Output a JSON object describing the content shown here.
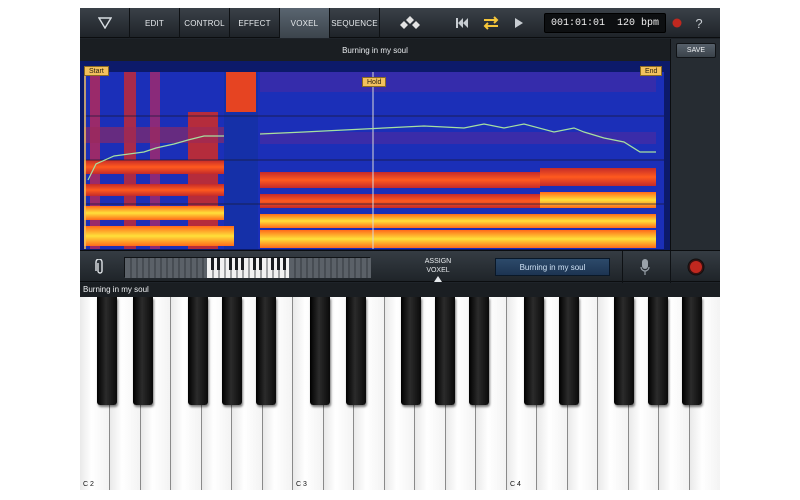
{
  "toolbar": {
    "tabs": [
      "EDIT",
      "CONTROL",
      "EFFECT",
      "VOXEL",
      "SEQUENCE"
    ],
    "active_tab": "VOXEL",
    "time": "001:01:01",
    "tempo": "120 bpm",
    "help": "?"
  },
  "editor": {
    "track_title": "Burning in my soul",
    "marker_start": "Start",
    "marker_hold": "Hold",
    "marker_end": "End",
    "save_label": "SAVE"
  },
  "control_bar": {
    "assign_line1": "ASSIGN",
    "assign_line2": "VOXEL",
    "phrase": "Burning in my soul"
  },
  "keyboard": {
    "phrase_label": "Burning in my soul",
    "octave_labels": [
      "C 2",
      "C 3",
      "C 4"
    ]
  },
  "colors": {
    "accent_active": "#4d5863",
    "record": "#c0281f",
    "spectro_low": "#1b2fb8",
    "spectro_high": "#f9e23a"
  }
}
